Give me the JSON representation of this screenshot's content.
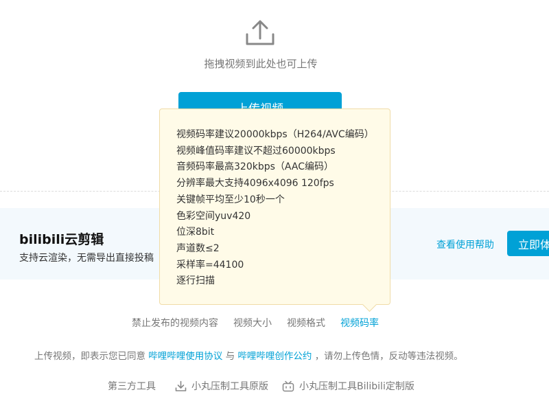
{
  "upload": {
    "drag_hint": "拖拽视频到此处也可上传",
    "button_label": "上传视频"
  },
  "promo": {
    "title": "bilibili云剪辑",
    "desc": "支持云渲染，无需导出直接投稿",
    "help_link": "查看使用帮助",
    "try_button": "立即体验"
  },
  "tooltip": {
    "lines": [
      "视频码率建议20000kbps（H264/AVC编码）",
      "视频峰值码率建议不超过60000kbps",
      "音频码率最高320kbps（AAC编码）",
      "分辨率最大支持4096x4096 120fps",
      "关键帧平均至少10秒一个",
      "色彩空间yuv420",
      "位深8bit",
      "声道数≤2",
      "采样率=44100",
      "逐行扫描"
    ]
  },
  "tabs": [
    {
      "label": "禁止发布的视频内容"
    },
    {
      "label": "视频大小"
    },
    {
      "label": "视频格式"
    },
    {
      "label": "视频码率",
      "active": true
    }
  ],
  "agreement": {
    "prefix": "上传视频，即表示您已同意",
    "link1": "哔哩哔哩使用协议",
    "mid": "与",
    "link2": "哔哩哔哩创作公约",
    "suffix": "，请勿上传色情，反动等违法视频。"
  },
  "tools": {
    "label": "第三方工具",
    "items": [
      "小丸压制工具原版",
      "小丸压制工具Bilibili定制版"
    ]
  },
  "colors": {
    "accent": "#00a1d6",
    "tooltip_bg": "#fffbe8",
    "promo_bg": "#f3f9fd"
  },
  "icons": [
    "upload-icon",
    "download-icon",
    "bilibili-tv-icon"
  ]
}
